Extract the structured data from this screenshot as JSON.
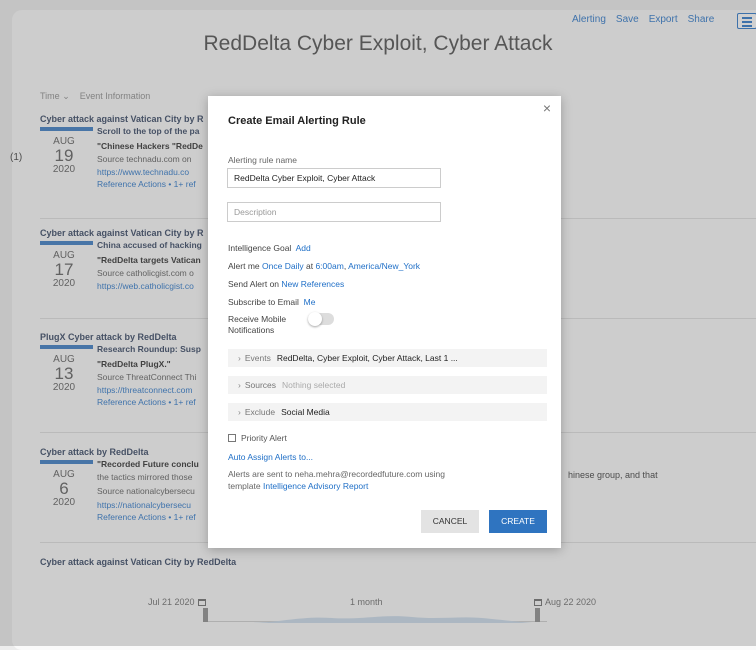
{
  "header": {
    "links": [
      "Alerting",
      "Save",
      "Export",
      "Share"
    ],
    "title": "RedDelta Cyber Exploit, Cyber Attack"
  },
  "columns": [
    "Time",
    "Event Information"
  ],
  "side_count": "(1)",
  "events": [
    {
      "title": "Cyber attack against Vatican City by R",
      "month": "AUG",
      "day": "19",
      "year": "2020",
      "lines": [
        "Scroll to the top of the pa",
        "\"Chinese Hackers \"RedDe",
        "Source technadu.com on",
        "https://www.technadu.co",
        "Reference Actions • 1+ ref"
      ]
    },
    {
      "title": "Cyber attack against Vatican City by R",
      "month": "AUG",
      "day": "17",
      "year": "2020",
      "lines": [
        "China accused of hacking",
        "\"RedDelta targets Vatican",
        "Source catholicgist.com o",
        "https://web.catholicgist.co"
      ]
    },
    {
      "title": "PlugX Cyber attack by RedDelta",
      "month": "AUG",
      "day": "13",
      "year": "2020",
      "lines": [
        "Research Roundup: Susp",
        "\"RedDelta PlugX.\"",
        "Source ThreatConnect Thi",
        "https://threatconnect.com",
        "Reference Actions • 1+ ref"
      ]
    },
    {
      "title": "Cyber attack by RedDelta",
      "month": "AUG",
      "day": "6",
      "year": "2020",
      "lines": [
        "\"Recorded Future conclu",
        "the tactics mirrored those",
        "Source nationalcybersecu",
        "https://nationalcybersecu",
        "Reference Actions • 1+ ref"
      ]
    }
  ],
  "event4_right_text": "hinese group, and that",
  "bottom_event": "Cyber attack against Vatican City by RedDelta",
  "timeline": {
    "start": "Jul 21 2020",
    "mid": "1 month",
    "end": "Aug 22 2020"
  },
  "modal": {
    "close": "×",
    "title": "Create Email Alerting Rule",
    "rule_name_label": "Alerting rule name",
    "rule_name_value": "RedDelta Cyber Exploit, Cyber Attack",
    "description_placeholder": "Description",
    "goal_label": "Intelligence Goal",
    "goal_link": "Add",
    "alert_me_prefix": "Alert me",
    "alert_frequency": "Once Daily",
    "alert_at": "at",
    "alert_time": "6:00am",
    "alert_tz": "America/New_York",
    "send_on_label": "Send Alert on",
    "send_on_value": "New References",
    "subscribe_label": "Subscribe to Email",
    "subscribe_value": "Me",
    "mobile_label_1": "Receive Mobile",
    "mobile_label_2": "Notifications",
    "mobile_enabled": false,
    "filters": [
      {
        "name": "Events",
        "value": "RedDelta, Cyber Exploit, Cyber Attack, Last 1 ..."
      },
      {
        "name": "Sources",
        "value": "Nothing selected"
      },
      {
        "name": "Exclude",
        "value": "Social Media"
      }
    ],
    "priority_label": "Priority Alert",
    "priority_checked": false,
    "auto_assign": "Auto Assign Alerts to...",
    "info_line1": "Alerts are sent to neha.mehra@recordedfuture.com using",
    "info_line2_prefix": "template",
    "info_template": "Intelligence Advisory Report",
    "cancel": "CANCEL",
    "create": "CREATE"
  },
  "colors": {
    "accent": "#2f74c0",
    "link": "#1f6fc7"
  }
}
